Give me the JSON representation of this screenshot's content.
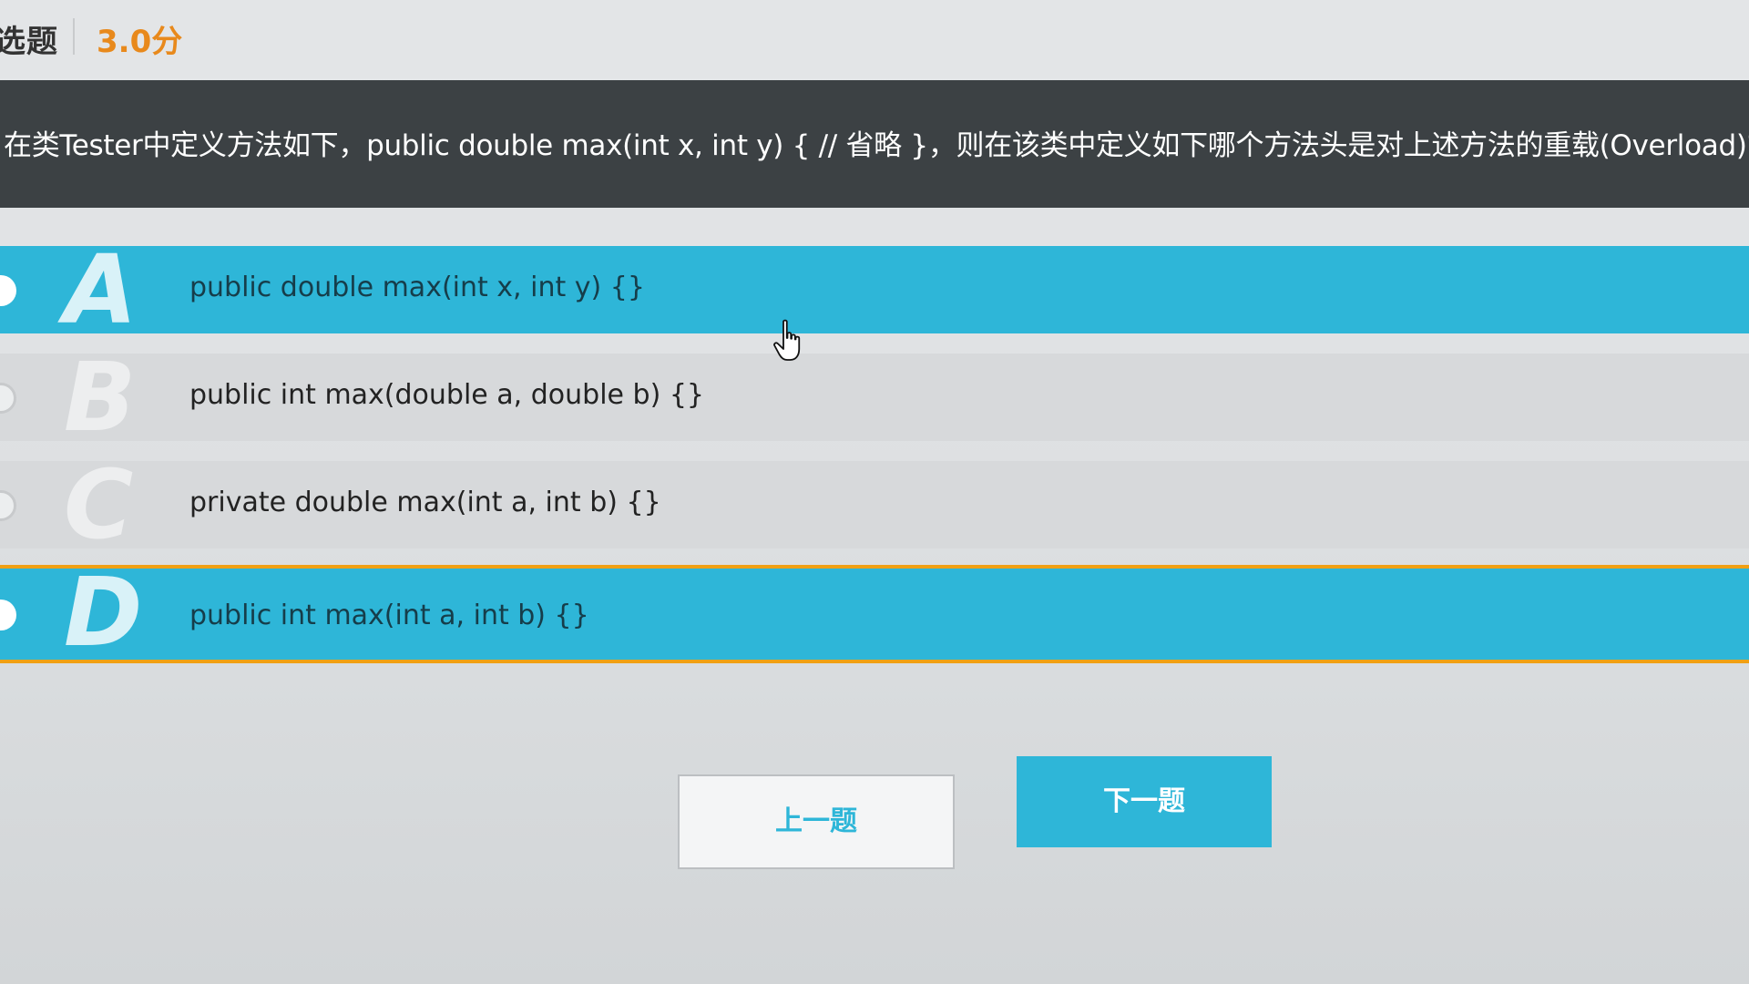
{
  "header": {
    "question_type": "选题",
    "score": "3.0分"
  },
  "question": {
    "text": "在类Tester中定义方法如下，public double max(int x, int y) { // 省略 }，则在该类中定义如下哪个方法头是对上述方法的重载(Overload)?"
  },
  "options": [
    {
      "letter": "A",
      "text": "public double max(int x, int y) {}",
      "state": "hover"
    },
    {
      "letter": "B",
      "text": "public int max(double a, double b) {}",
      "state": "normal"
    },
    {
      "letter": "C",
      "text": "private double max(int a, int b) {}",
      "state": "normal"
    },
    {
      "letter": "D",
      "text": "public int max(int a, int b) {}",
      "state": "selected"
    }
  ],
  "buttons": {
    "prev_label": "上一题",
    "next_label": "下一题"
  },
  "colors": {
    "accent": "#2eb6d8",
    "score": "#e8891c",
    "selected_border": "#f0a014",
    "question_bg": "#3c4144"
  },
  "icons": {
    "cursor": "hand-pointer-icon",
    "radio": "radio-icon"
  }
}
